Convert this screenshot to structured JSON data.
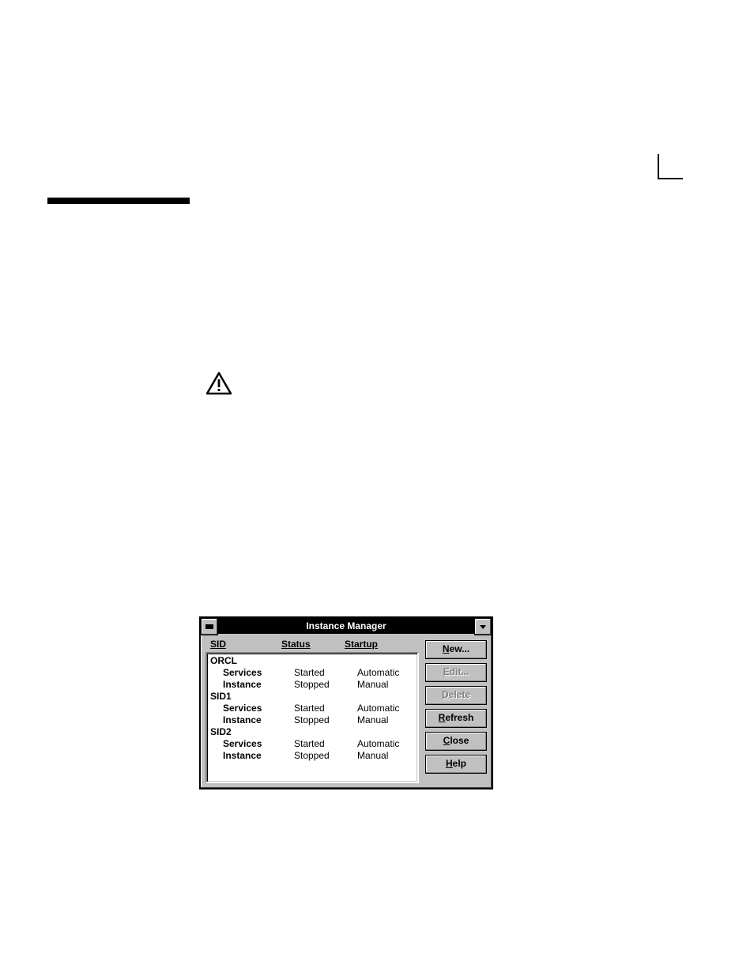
{
  "dialog": {
    "title": "Instance Manager",
    "headers": {
      "sid": "SID",
      "status": "Status",
      "startup": "Startup"
    },
    "rows": [
      {
        "kind": "parent",
        "sid": "ORCL",
        "status": "",
        "startup": ""
      },
      {
        "kind": "child",
        "sid": "Services",
        "status": "Started",
        "startup": "Automatic"
      },
      {
        "kind": "child",
        "sid": "Instance",
        "status": "Stopped",
        "startup": "Manual"
      },
      {
        "kind": "parent",
        "sid": "SID1",
        "status": "",
        "startup": ""
      },
      {
        "kind": "child",
        "sid": "Services",
        "status": "Started",
        "startup": "Automatic"
      },
      {
        "kind": "child",
        "sid": "Instance",
        "status": "Stopped",
        "startup": "Manual"
      },
      {
        "kind": "parent",
        "sid": "SID2",
        "status": "",
        "startup": ""
      },
      {
        "kind": "child",
        "sid": "Services",
        "status": "Started",
        "startup": "Automatic"
      },
      {
        "kind": "child",
        "sid": "Instance",
        "status": "Stopped",
        "startup": "Manual"
      }
    ],
    "buttons": {
      "new": {
        "pre": "",
        "mn": "N",
        "post": "ew...",
        "disabled": false
      },
      "edit": {
        "pre": "",
        "mn": "E",
        "post": "dit...",
        "disabled": true
      },
      "delete": {
        "pre": "",
        "mn": "D",
        "post": "elete",
        "disabled": true
      },
      "refresh": {
        "pre": "",
        "mn": "R",
        "post": "efresh",
        "disabled": false
      },
      "close": {
        "pre": "",
        "mn": "C",
        "post": "lose",
        "disabled": false
      },
      "help": {
        "pre": "",
        "mn": "H",
        "post": "elp",
        "disabled": false
      }
    }
  }
}
